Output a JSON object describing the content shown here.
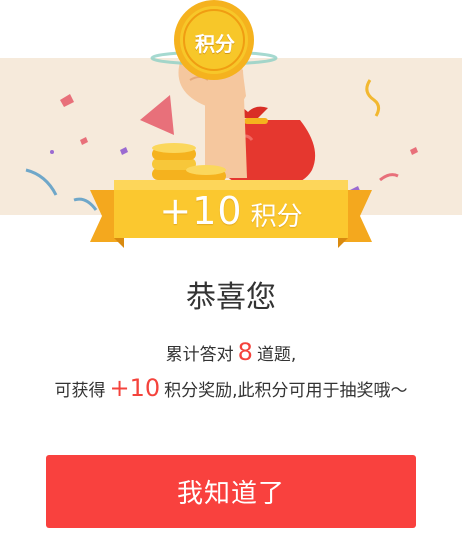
{
  "colors": {
    "header_bg": "#f6eadb",
    "ribbon": "#f9c12f",
    "coin": "#f7c21a",
    "highlight": "#f4433c",
    "button": "#f9413e",
    "text": "#333333"
  },
  "header": {
    "coin_label": "积分",
    "ribbon_amount": "+10",
    "ribbon_unit": "积分"
  },
  "dialog": {
    "title": "恭喜您",
    "line1_prefix": "累计答对",
    "line1_count": "8",
    "line1_suffix": "道题,",
    "line2_prefix": "可获得",
    "line2_points": "+10",
    "line2_suffix": "积分奖励,此积分可用于抽奖哦～"
  },
  "actions": {
    "confirm_label": "我知道了"
  }
}
